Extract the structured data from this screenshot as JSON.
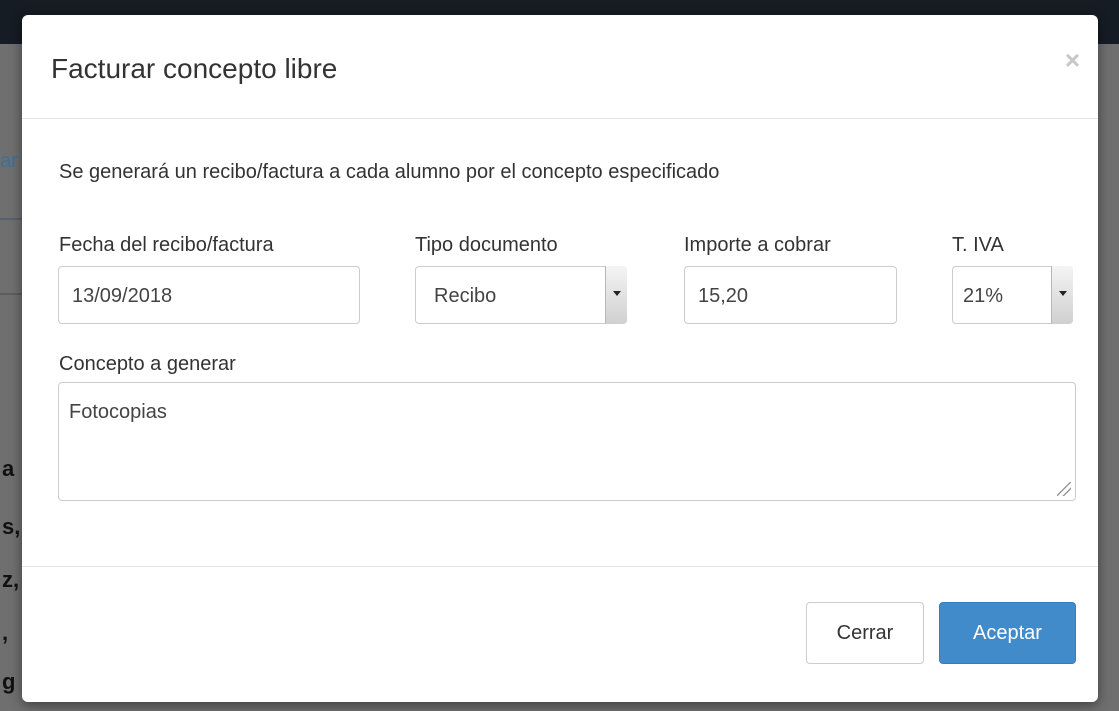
{
  "background": {
    "fragment": "ar",
    "letters": [
      "a",
      "s,",
      "z,",
      ",",
      "g"
    ]
  },
  "modal": {
    "title": "Facturar concepto libre",
    "close_symbol": "×",
    "intro_text": "Se generará un recibo/factura a cada alumno por el concepto especificado",
    "fields": {
      "fecha": {
        "label": "Fecha del recibo/factura",
        "value": "13/09/2018"
      },
      "tipo": {
        "label": "Tipo documento",
        "value": "Recibo"
      },
      "importe": {
        "label": "Importe a cobrar",
        "value": "15,20"
      },
      "iva": {
        "label": "T. IVA",
        "value": "21%"
      },
      "concepto": {
        "label": "Concepto a generar",
        "value": "Fotocopias"
      }
    },
    "buttons": {
      "cerrar": "Cerrar",
      "aceptar": "Aceptar"
    }
  },
  "colors": {
    "primary": "#428bca",
    "overlay": "#6f6f6f",
    "topbar": "#161c24"
  }
}
